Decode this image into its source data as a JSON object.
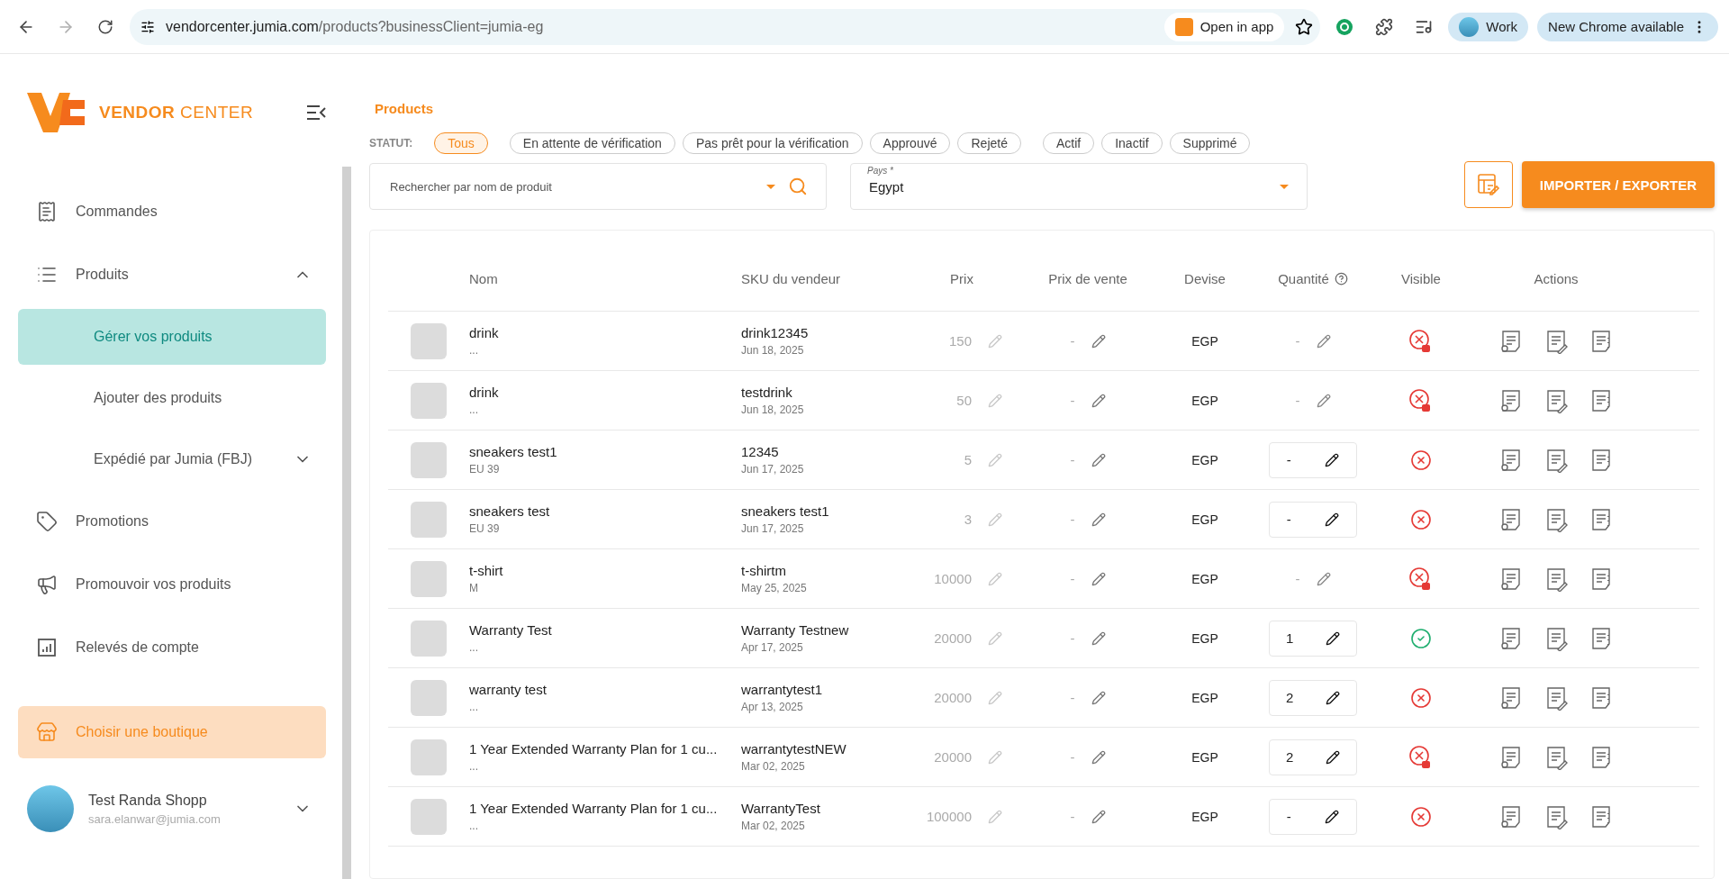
{
  "browser": {
    "url_host": "vendorcenter.jumia.com",
    "url_path": "/products?businessClient=jumia-eg",
    "open_in_app": "Open in app",
    "profile": "Work",
    "update": "New Chrome available"
  },
  "sidebar": {
    "brand": "**VENDOR** CENTER",
    "items": [
      {
        "kind": "orders",
        "label": "Commandes"
      },
      {
        "kind": "products",
        "label": "Produits",
        "expanded": true,
        "children": [
          {
            "label": "Gérer vos produits",
            "selected": true
          },
          {
            "label": "Ajouter des produits",
            "selected": false
          },
          {
            "label": "Expédié par Jumia (FBJ)",
            "selected": false,
            "expanded": false
          }
        ]
      },
      {
        "kind": "promotions",
        "label": "Promotions"
      },
      {
        "kind": "promote",
        "label": "Promouvoir vos produits"
      },
      {
        "kind": "statements",
        "label": "Relevés de compte"
      }
    ],
    "shop_button": "Choisir une boutique",
    "user": {
      "name": "Test Randa Shopp",
      "email": "sara.elanwar@jumia.com"
    }
  },
  "breadcrumb": "Products",
  "status_filter": {
    "label": "STATUT:",
    "groups": [
      [
        {
          "label": "Tous",
          "selected": true
        }
      ],
      [
        {
          "label": "En attente de vérification",
          "selected": false
        },
        {
          "label": "Pas prêt pour la vérification",
          "selected": false
        },
        {
          "label": "Approuvé",
          "selected": false
        },
        {
          "label": "Rejeté",
          "selected": false
        }
      ],
      [
        {
          "label": "Actif",
          "selected": false
        },
        {
          "label": "Inactif",
          "selected": false
        },
        {
          "label": "Supprimé",
          "selected": false
        }
      ]
    ]
  },
  "import_export": "IMPORTER / EXPORTER",
  "search": {
    "placeholder": "Rechercher par nom de produit"
  },
  "country": {
    "label": "Pays *",
    "value": "Egypt"
  },
  "table": {
    "columns": [
      "Nom",
      "SKU du vendeur",
      "Prix",
      "Prix de vente",
      "Devise",
      "Quantité",
      "Visible",
      "Actions"
    ],
    "rows": [
      {
        "name": "drink",
        "variant": "...",
        "sku": "drink12345",
        "date": "Jun 18, 2025",
        "price": "150",
        "sale_price": "-",
        "currency": "EGP",
        "quantity": "-",
        "quantity_editable": false,
        "visible": false,
        "locked": true
      },
      {
        "name": "drink",
        "variant": "...",
        "sku": "testdrink",
        "date": "Jun 18, 2025",
        "price": "50",
        "sale_price": "-",
        "currency": "EGP",
        "quantity": "-",
        "quantity_editable": false,
        "visible": false,
        "locked": true
      },
      {
        "name": "sneakers test1",
        "variant": "EU 39",
        "sku": "12345",
        "date": "Jun 17, 2025",
        "price": "5",
        "sale_price": "-",
        "currency": "EGP",
        "quantity": "-",
        "quantity_editable": true,
        "visible": false,
        "locked": false
      },
      {
        "name": "sneakers test",
        "variant": "EU 39",
        "sku": "sneakers test1",
        "date": "Jun 17, 2025",
        "price": "3",
        "sale_price": "-",
        "currency": "EGP",
        "quantity": "-",
        "quantity_editable": true,
        "visible": false,
        "locked": false
      },
      {
        "name": "t-shirt",
        "variant": "M",
        "sku": "t-shirtm",
        "date": "May 25, 2025",
        "price": "10000",
        "sale_price": "-",
        "currency": "EGP",
        "quantity": "-",
        "quantity_editable": false,
        "visible": false,
        "locked": true
      },
      {
        "name": "Warranty Test",
        "variant": "...",
        "sku": "Warranty Testnew",
        "date": "Apr 17, 2025",
        "price": "20000",
        "sale_price": "-",
        "currency": "EGP",
        "quantity": "1",
        "quantity_editable": true,
        "visible": true
      },
      {
        "name": "warranty test",
        "variant": "...",
        "sku": "warrantytest1",
        "date": "Apr 13, 2025",
        "price": "20000",
        "sale_price": "-",
        "currency": "EGP",
        "quantity": "2",
        "quantity_editable": true,
        "visible": false,
        "locked": false
      },
      {
        "name": "1 Year Extended Warranty Plan for 1 cu...",
        "variant": "...",
        "sku": "warrantytestNEW",
        "date": "Mar 02, 2025",
        "price": "20000",
        "sale_price": "-",
        "currency": "EGP",
        "quantity": "2",
        "quantity_editable": true,
        "visible": false,
        "locked": true
      },
      {
        "name": "1 Year Extended Warranty Plan for 1 cu...",
        "variant": "...",
        "sku": "WarrantyTest",
        "date": "Mar 02, 2025",
        "price": "100000",
        "sale_price": "-",
        "currency": "EGP",
        "quantity": "-",
        "quantity_editable": true,
        "visible": false,
        "locked": false
      }
    ]
  }
}
